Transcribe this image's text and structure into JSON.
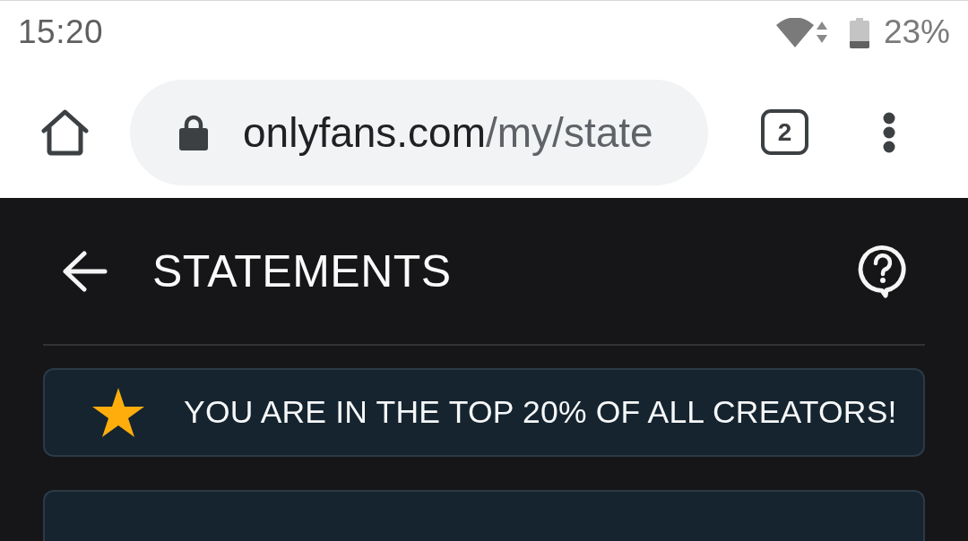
{
  "status_bar": {
    "time": "15:20",
    "battery_percent": "23%"
  },
  "browser_bar": {
    "url_host": "onlyfans.com",
    "url_path": "/my/state",
    "tab_count": "2"
  },
  "page": {
    "title": "STATEMENTS"
  },
  "banner": {
    "text": "YOU ARE IN THE TOP 20% OF ALL CREATORS!"
  }
}
